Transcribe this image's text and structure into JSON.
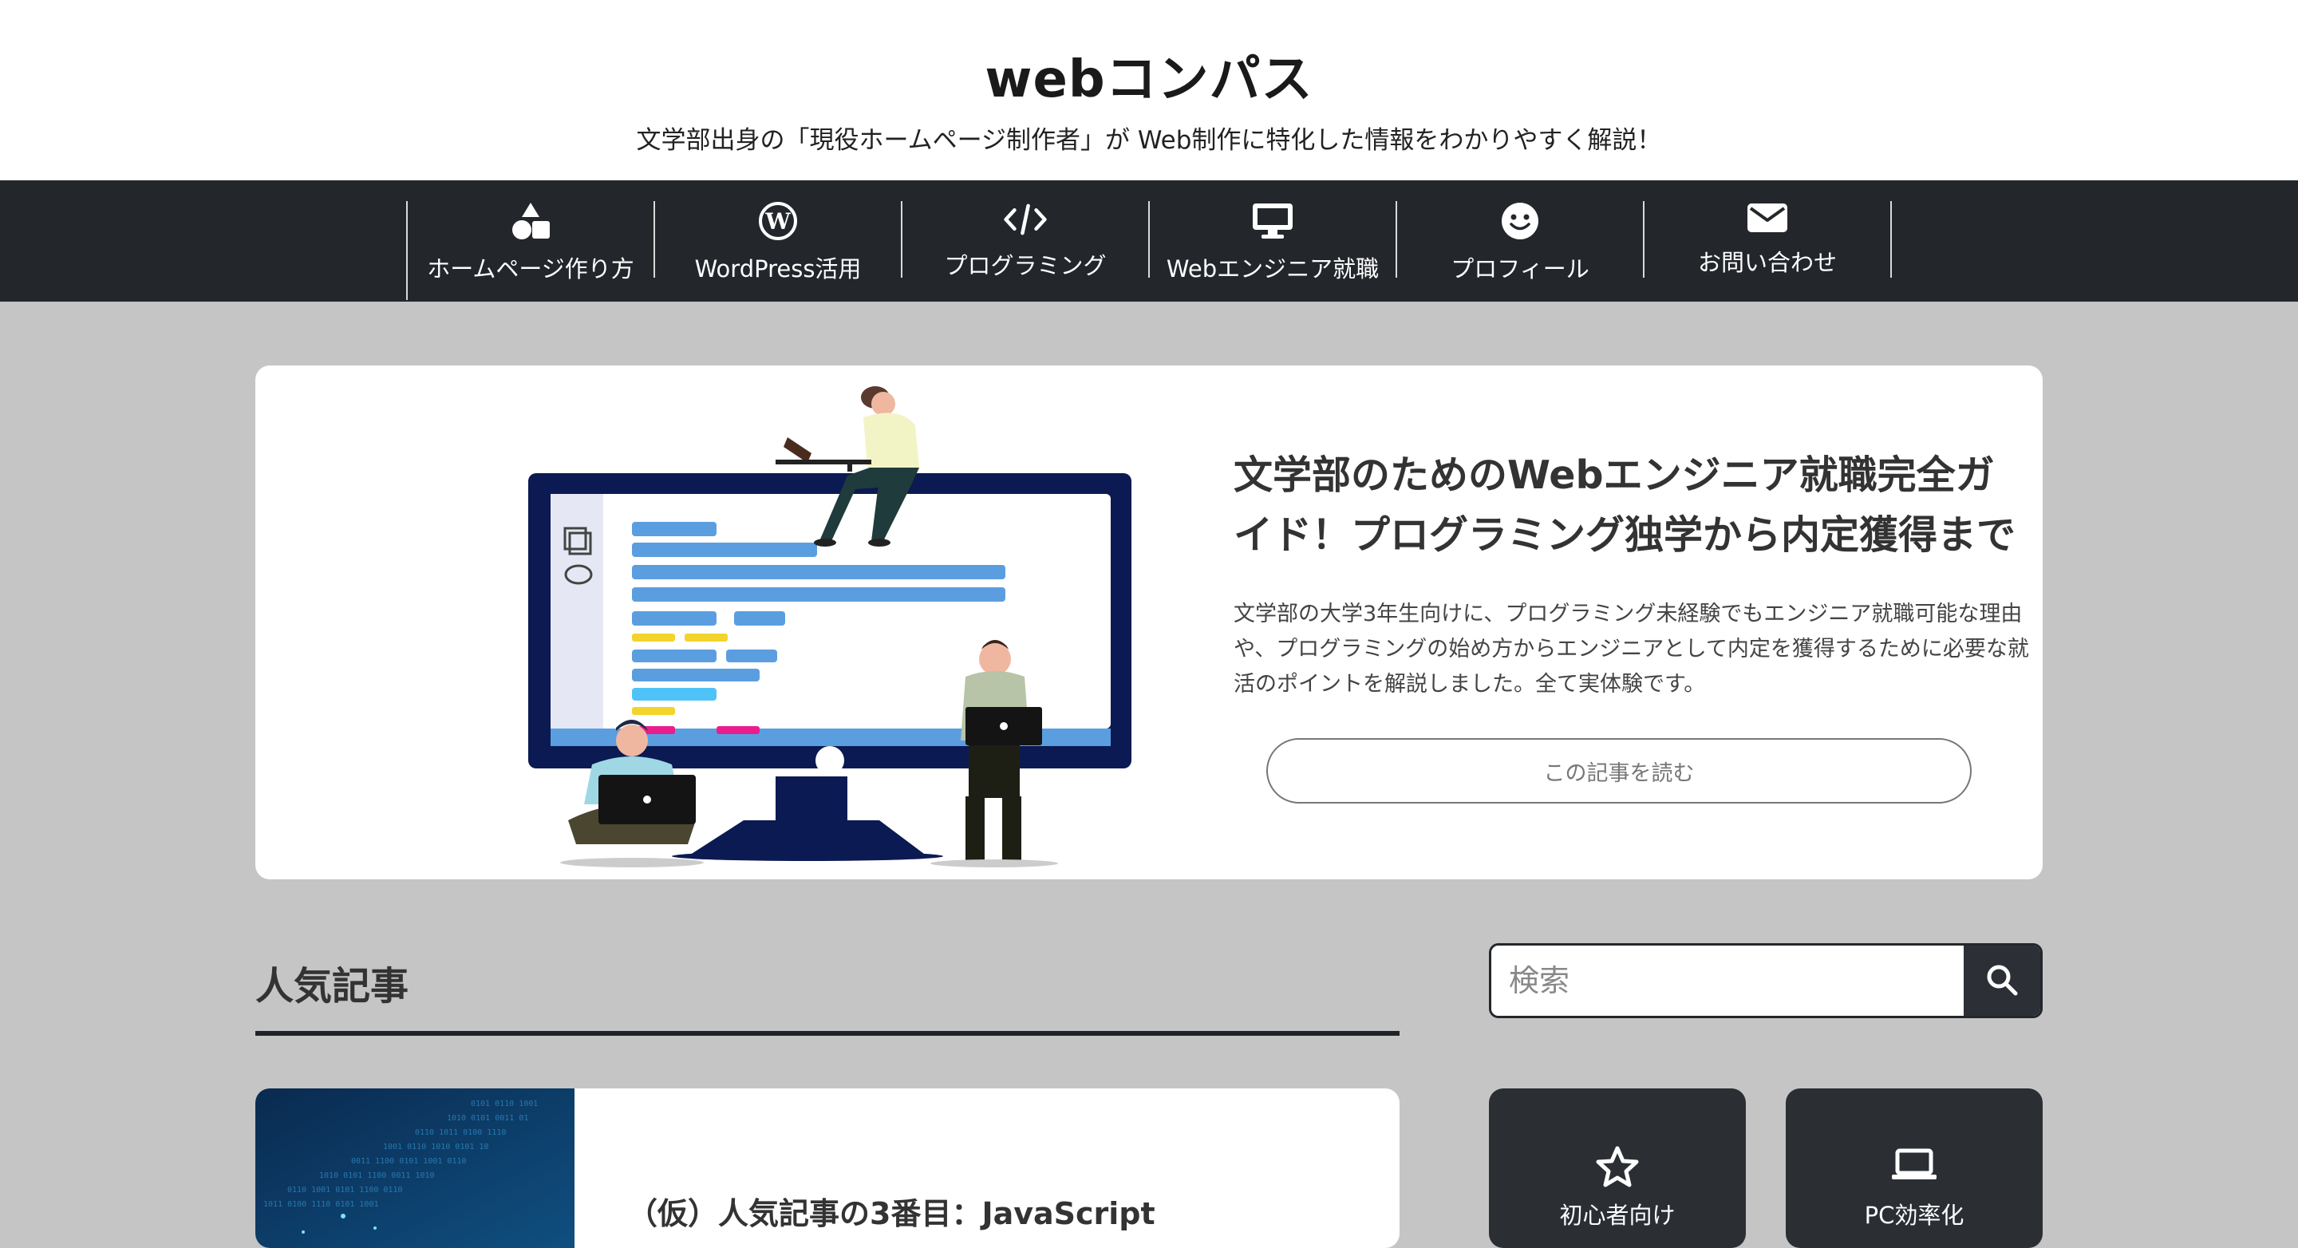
{
  "site": {
    "title": "webコンパス",
    "tagline": "文学部出身の「現役ホームページ制作者」が Web制作に特化した情報をわかりやすく解説！"
  },
  "nav": {
    "items": [
      {
        "label": "ホームページ作り方",
        "icon": "shapes-icon"
      },
      {
        "label": "WordPress活用",
        "icon": "wordpress-icon"
      },
      {
        "label": "プログラミング",
        "icon": "code-icon"
      },
      {
        "label": "Webエンジニア就職",
        "icon": "monitor-icon"
      },
      {
        "label": "プロフィール",
        "icon": "smile-icon"
      },
      {
        "label": "お問い合わせ",
        "icon": "envelope-icon"
      }
    ]
  },
  "hero": {
    "title": "文学部のためのWebエンジニア就職完全ガイド！プログラミング独学から内定獲得まで",
    "excerpt": "文学部の大学3年生向けに、プログラミング未経験でもエンジニア就職可能な理由や、プログラミングの始め方からエンジニアとして内定を獲得するために必要な就活のポイントを解説しました。全て実体験です。",
    "button": "この記事を読む"
  },
  "popular": {
    "heading": "人気記事",
    "posts": [
      {
        "title": "（仮）人気記事の3番目：JavaScript"
      }
    ]
  },
  "sidebar": {
    "search_placeholder": "検索",
    "categories": [
      {
        "label": "初心者向け",
        "icon": "star-icon"
      },
      {
        "label": "PC効率化",
        "icon": "laptop-icon"
      }
    ]
  },
  "colors": {
    "nav_bg": "#23272c",
    "page_bg": "#c5c5c5",
    "illustration_navy": "#0b1a52",
    "illustration_blue": "#5b9ee0"
  }
}
